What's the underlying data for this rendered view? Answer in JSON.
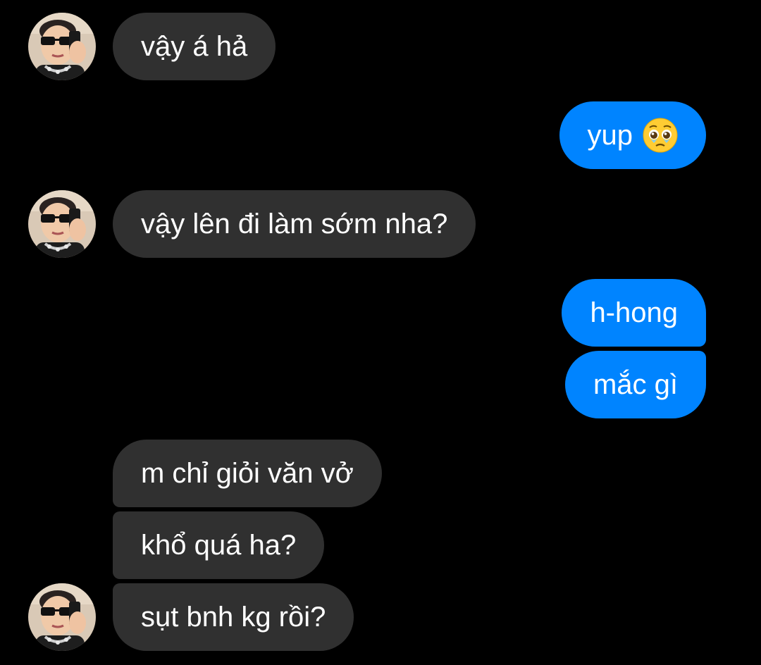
{
  "colors": {
    "background": "#000000",
    "incoming_bubble": "#303030",
    "outgoing_bubble": "#0084ff",
    "text": "#ffffff"
  },
  "messages": [
    {
      "sender": "contact",
      "text": "vậy á hả",
      "avatar": "profile-photo"
    },
    {
      "sender": "me",
      "text": "yup",
      "emoji": "pleading-face-icon"
    },
    {
      "sender": "contact",
      "text": "vậy lên đi làm sớm nha?",
      "avatar": "profile-photo"
    },
    {
      "sender": "me",
      "text": "h-hong"
    },
    {
      "sender": "me",
      "text": "mắc gì"
    },
    {
      "sender": "contact",
      "text": "m chỉ giỏi văn vở"
    },
    {
      "sender": "contact",
      "text": "khổ quá ha?"
    },
    {
      "sender": "contact",
      "text": "sụt bnh kg rồi?",
      "avatar": "profile-photo"
    }
  ]
}
